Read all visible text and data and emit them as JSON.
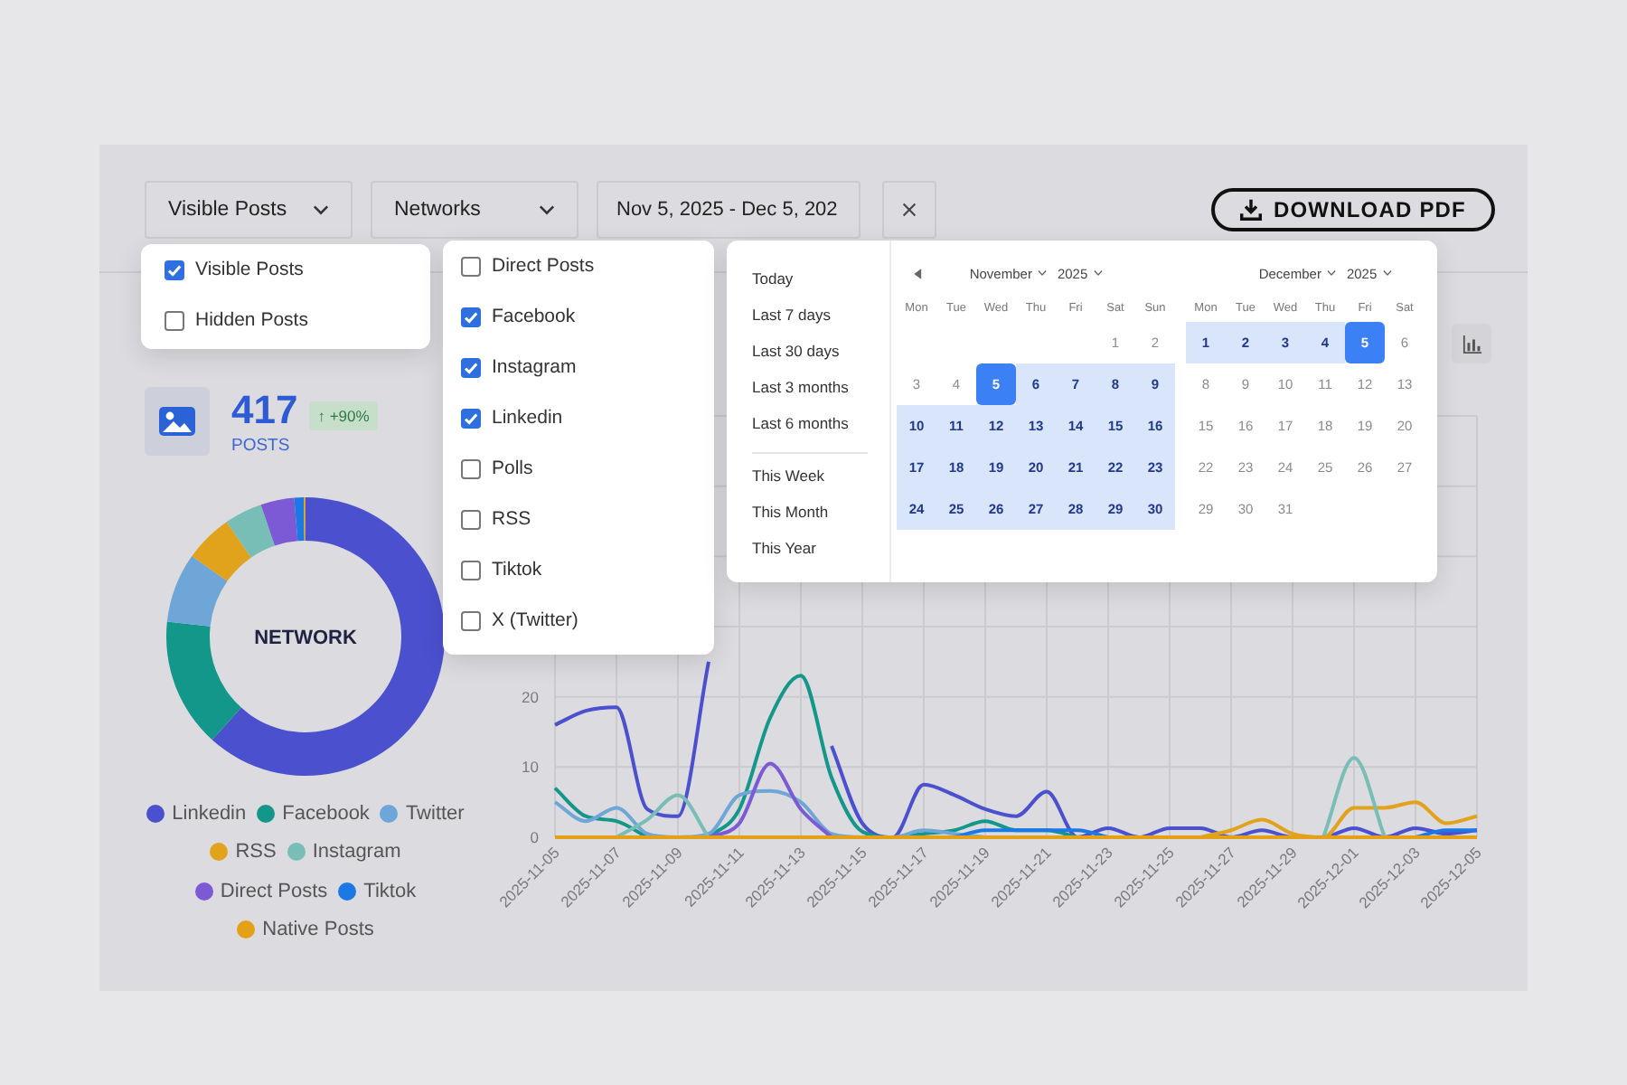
{
  "toolbar": {
    "visibility_select": {
      "value": "Visible Posts"
    },
    "network_select": {
      "value": "Networks"
    },
    "date_range": {
      "value": "Nov 5, 2025 - Dec 5, 202"
    },
    "download_button": {
      "label": "DOWNLOAD PDF"
    }
  },
  "visibility_menu": {
    "options": [
      {
        "label": "Visible Posts",
        "checked": true
      },
      {
        "label": "Hidden Posts",
        "checked": false
      }
    ]
  },
  "network_menu": {
    "options": [
      {
        "label": "Direct Posts",
        "checked": false
      },
      {
        "label": "Facebook",
        "checked": true
      },
      {
        "label": "Instagram",
        "checked": true
      },
      {
        "label": "Linkedin",
        "checked": true
      },
      {
        "label": "Polls",
        "checked": false
      },
      {
        "label": "RSS",
        "checked": false
      },
      {
        "label": "Tiktok",
        "checked": false
      },
      {
        "label": "X (Twitter)",
        "checked": false
      }
    ]
  },
  "date_picker": {
    "preset_groups": [
      [
        "Today",
        "Last 7 days",
        "Last 30 days",
        "Last 3 months",
        "Last 6 months"
      ],
      [
        "This Week",
        "This Month",
        "This Year"
      ]
    ],
    "months": [
      {
        "month": "November",
        "year": "2025",
        "weekdays": [
          "Mon",
          "Tue",
          "Wed",
          "Thu",
          "Fri",
          "Sat",
          "Sun"
        ],
        "weeks": [
          [
            {
              "label": "1",
              "selected": false,
              "in_range": false
            },
            {
              "label": "2",
              "selected": false,
              "in_range": false
            }
          ],
          [
            {
              "label": "3",
              "selected": false,
              "in_range": false
            },
            {
              "label": "4",
              "selected": false,
              "in_range": false
            },
            {
              "label": "5",
              "selected": true,
              "in_range": true
            },
            {
              "label": "6",
              "selected": false,
              "in_range": true
            },
            {
              "label": "7",
              "selected": false,
              "in_range": true
            },
            {
              "label": "8",
              "selected": false,
              "in_range": true
            },
            {
              "label": "9",
              "selected": false,
              "in_range": true
            }
          ],
          [
            {
              "label": "10",
              "selected": false,
              "in_range": true
            },
            {
              "label": "11",
              "selected": false,
              "in_range": true
            },
            {
              "label": "12",
              "selected": false,
              "in_range": true
            },
            {
              "label": "13",
              "selected": false,
              "in_range": true
            },
            {
              "label": "14",
              "selected": false,
              "in_range": true
            },
            {
              "label": "15",
              "selected": false,
              "in_range": true
            },
            {
              "label": "16",
              "selected": false,
              "in_range": true
            }
          ],
          [
            {
              "label": "17",
              "selected": false,
              "in_range": true
            },
            {
              "label": "18",
              "selected": false,
              "in_range": true
            },
            {
              "label": "19",
              "selected": false,
              "in_range": true
            },
            {
              "label": "20",
              "selected": false,
              "in_range": true
            },
            {
              "label": "21",
              "selected": false,
              "in_range": true
            },
            {
              "label": "22",
              "selected": false,
              "in_range": true
            },
            {
              "label": "23",
              "selected": false,
              "in_range": true
            }
          ],
          [
            {
              "label": "24",
              "selected": false,
              "in_range": true
            },
            {
              "label": "25",
              "selected": false,
              "in_range": true
            },
            {
              "label": "26",
              "selected": false,
              "in_range": true
            },
            {
              "label": "27",
              "selected": false,
              "in_range": true
            },
            {
              "label": "28",
              "selected": false,
              "in_range": true
            },
            {
              "label": "29",
              "selected": false,
              "in_range": true
            },
            {
              "label": "30",
              "selected": false,
              "in_range": true
            }
          ]
        ]
      },
      {
        "month": "December",
        "year": "2025",
        "weekdays": [
          "Mon",
          "Tue",
          "Wed",
          "Thu",
          "Fri",
          "Sat"
        ],
        "weeks": [
          [
            {
              "label": "1",
              "selected": false,
              "in_range": true
            },
            {
              "label": "2",
              "selected": false,
              "in_range": true
            },
            {
              "label": "3",
              "selected": false,
              "in_range": true
            },
            {
              "label": "4",
              "selected": false,
              "in_range": true
            },
            {
              "label": "5",
              "selected": true,
              "in_range": true
            },
            {
              "label": "6",
              "selected": false,
              "in_range": false
            }
          ],
          [
            {
              "label": "8",
              "selected": false,
              "in_range": false
            },
            {
              "label": "9",
              "selected": false,
              "in_range": false
            },
            {
              "label": "10",
              "selected": false,
              "in_range": false
            },
            {
              "label": "11",
              "selected": false,
              "in_range": false
            },
            {
              "label": "12",
              "selected": false,
              "in_range": false
            },
            {
              "label": "13",
              "selected": false,
              "in_range": false
            }
          ],
          [
            {
              "label": "15",
              "selected": false,
              "in_range": false
            },
            {
              "label": "16",
              "selected": false,
              "in_range": false
            },
            {
              "label": "17",
              "selected": false,
              "in_range": false
            },
            {
              "label": "18",
              "selected": false,
              "in_range": false
            },
            {
              "label": "19",
              "selected": false,
              "in_range": false
            },
            {
              "label": "20",
              "selected": false,
              "in_range": false
            }
          ],
          [
            {
              "label": "22",
              "selected": false,
              "in_range": false
            },
            {
              "label": "23",
              "selected": false,
              "in_range": false
            },
            {
              "label": "24",
              "selected": false,
              "in_range": false
            },
            {
              "label": "25",
              "selected": false,
              "in_range": false
            },
            {
              "label": "26",
              "selected": false,
              "in_range": false
            },
            {
              "label": "27",
              "selected": false,
              "in_range": false
            }
          ],
          [
            {
              "label": "29",
              "selected": false,
              "in_range": false
            },
            {
              "label": "30",
              "selected": false,
              "in_range": false
            },
            {
              "label": "31",
              "selected": false,
              "in_range": false
            }
          ]
        ]
      }
    ]
  },
  "summary": {
    "count": "417",
    "unit": "POSTS",
    "change": "↑ +90%"
  },
  "network_donut": {
    "center_label": "NETWORK",
    "legend": [
      {
        "label": "Linkedin",
        "color": "#4b50cf"
      },
      {
        "label": "Facebook",
        "color": "#13978b"
      },
      {
        "label": "Twitter",
        "color": "#6ea6d8"
      },
      {
        "label": "RSS",
        "color": "#e2a31c"
      },
      {
        "label": "Instagram",
        "color": "#79bdb7"
      },
      {
        "label": "Direct Posts",
        "color": "#7c5ad6"
      },
      {
        "label": "Tiktok",
        "color": "#1b78e4"
      },
      {
        "label": "Native Posts",
        "color": "#e4a017"
      }
    ]
  },
  "activity_chart": {
    "chart_data": {
      "type": "line",
      "grid": true,
      "categories": [
        "2025-11-05",
        null,
        "2025-11-07",
        null,
        "2025-11-09",
        null,
        "2025-11-11",
        null,
        "2025-11-13",
        null,
        "2025-11-15",
        null,
        "2025-11-17",
        null,
        "2025-11-19",
        null,
        "2025-11-21",
        null,
        "2025-11-23",
        null,
        "2025-11-25",
        null,
        "2025-11-27",
        null,
        "2025-11-29",
        null,
        "2025-12-01",
        null,
        "2025-12-03",
        null,
        "2025-12-05"
      ],
      "ylim": [
        0,
        60
      ],
      "yticks": [
        0,
        10,
        20
      ],
      "series": [
        {
          "color": "#4b50cf",
          "values": [
            16,
            18,
            18.5,
            4,
            3,
            25,
            null,
            null,
            null,
            13,
            2,
            0,
            7.5,
            6,
            4,
            3,
            6.5,
            0,
            1.3,
            0,
            1.3,
            1.3,
            0,
            1,
            0,
            0,
            1.3,
            0,
            1.3,
            0.5,
            1
          ]
        },
        {
          "color": "#13978b",
          "values": [
            7,
            3,
            2.3,
            0,
            null,
            0,
            4,
            17,
            23,
            8.5,
            0.8,
            0,
            0.5,
            1,
            2.3,
            1,
            1,
            0,
            null,
            null,
            null,
            null,
            null,
            null,
            null,
            null,
            null,
            null,
            null,
            null,
            null
          ]
        },
        {
          "color": "#6ea6d8",
          "values": [
            5,
            2.3,
            4.2,
            0.5,
            0,
            0.5,
            6,
            6.6,
            5,
            0.5,
            0,
            0,
            1,
            0.5,
            0,
            null,
            null,
            null,
            null,
            null,
            null,
            null,
            null,
            null,
            null,
            null,
            null,
            null,
            null,
            null,
            null
          ]
        },
        {
          "color": "#e2a31c",
          "values": [
            null,
            null,
            null,
            null,
            null,
            null,
            null,
            null,
            null,
            null,
            null,
            null,
            null,
            null,
            null,
            null,
            null,
            null,
            null,
            null,
            null,
            0,
            1,
            2.5,
            0.5,
            0,
            4.2,
            4.2,
            5,
            2,
            3
          ]
        },
        {
          "color": "#79bdb7",
          "values": [
            null,
            null,
            0,
            2.5,
            6,
            0,
            null,
            null,
            null,
            null,
            null,
            null,
            null,
            null,
            null,
            null,
            null,
            null,
            null,
            null,
            null,
            null,
            null,
            null,
            null,
            0,
            11.3,
            0,
            null,
            null,
            null
          ]
        },
        {
          "color": "#7c5ad6",
          "values": [
            null,
            null,
            null,
            null,
            null,
            0,
            2,
            10.5,
            4,
            0,
            null,
            null,
            null,
            null,
            null,
            null,
            null,
            null,
            null,
            null,
            null,
            null,
            null,
            null,
            null,
            null,
            null,
            null,
            null,
            null,
            null
          ]
        },
        {
          "color": "#1b78e4",
          "values": [
            null,
            null,
            null,
            null,
            null,
            null,
            null,
            null,
            null,
            null,
            null,
            null,
            null,
            0,
            1,
            1,
            1,
            1,
            0,
            null,
            null,
            null,
            null,
            null,
            null,
            null,
            null,
            null,
            0,
            1,
            1
          ]
        },
        {
          "color": "#e4a017",
          "values": [
            0,
            0,
            0,
            0,
            0,
            0,
            0,
            0,
            0,
            0,
            0,
            0,
            0,
            0,
            0,
            0,
            0,
            0,
            0,
            0,
            0,
            0,
            0,
            0,
            0,
            0,
            0,
            0,
            0,
            0,
            0
          ]
        }
      ]
    }
  }
}
